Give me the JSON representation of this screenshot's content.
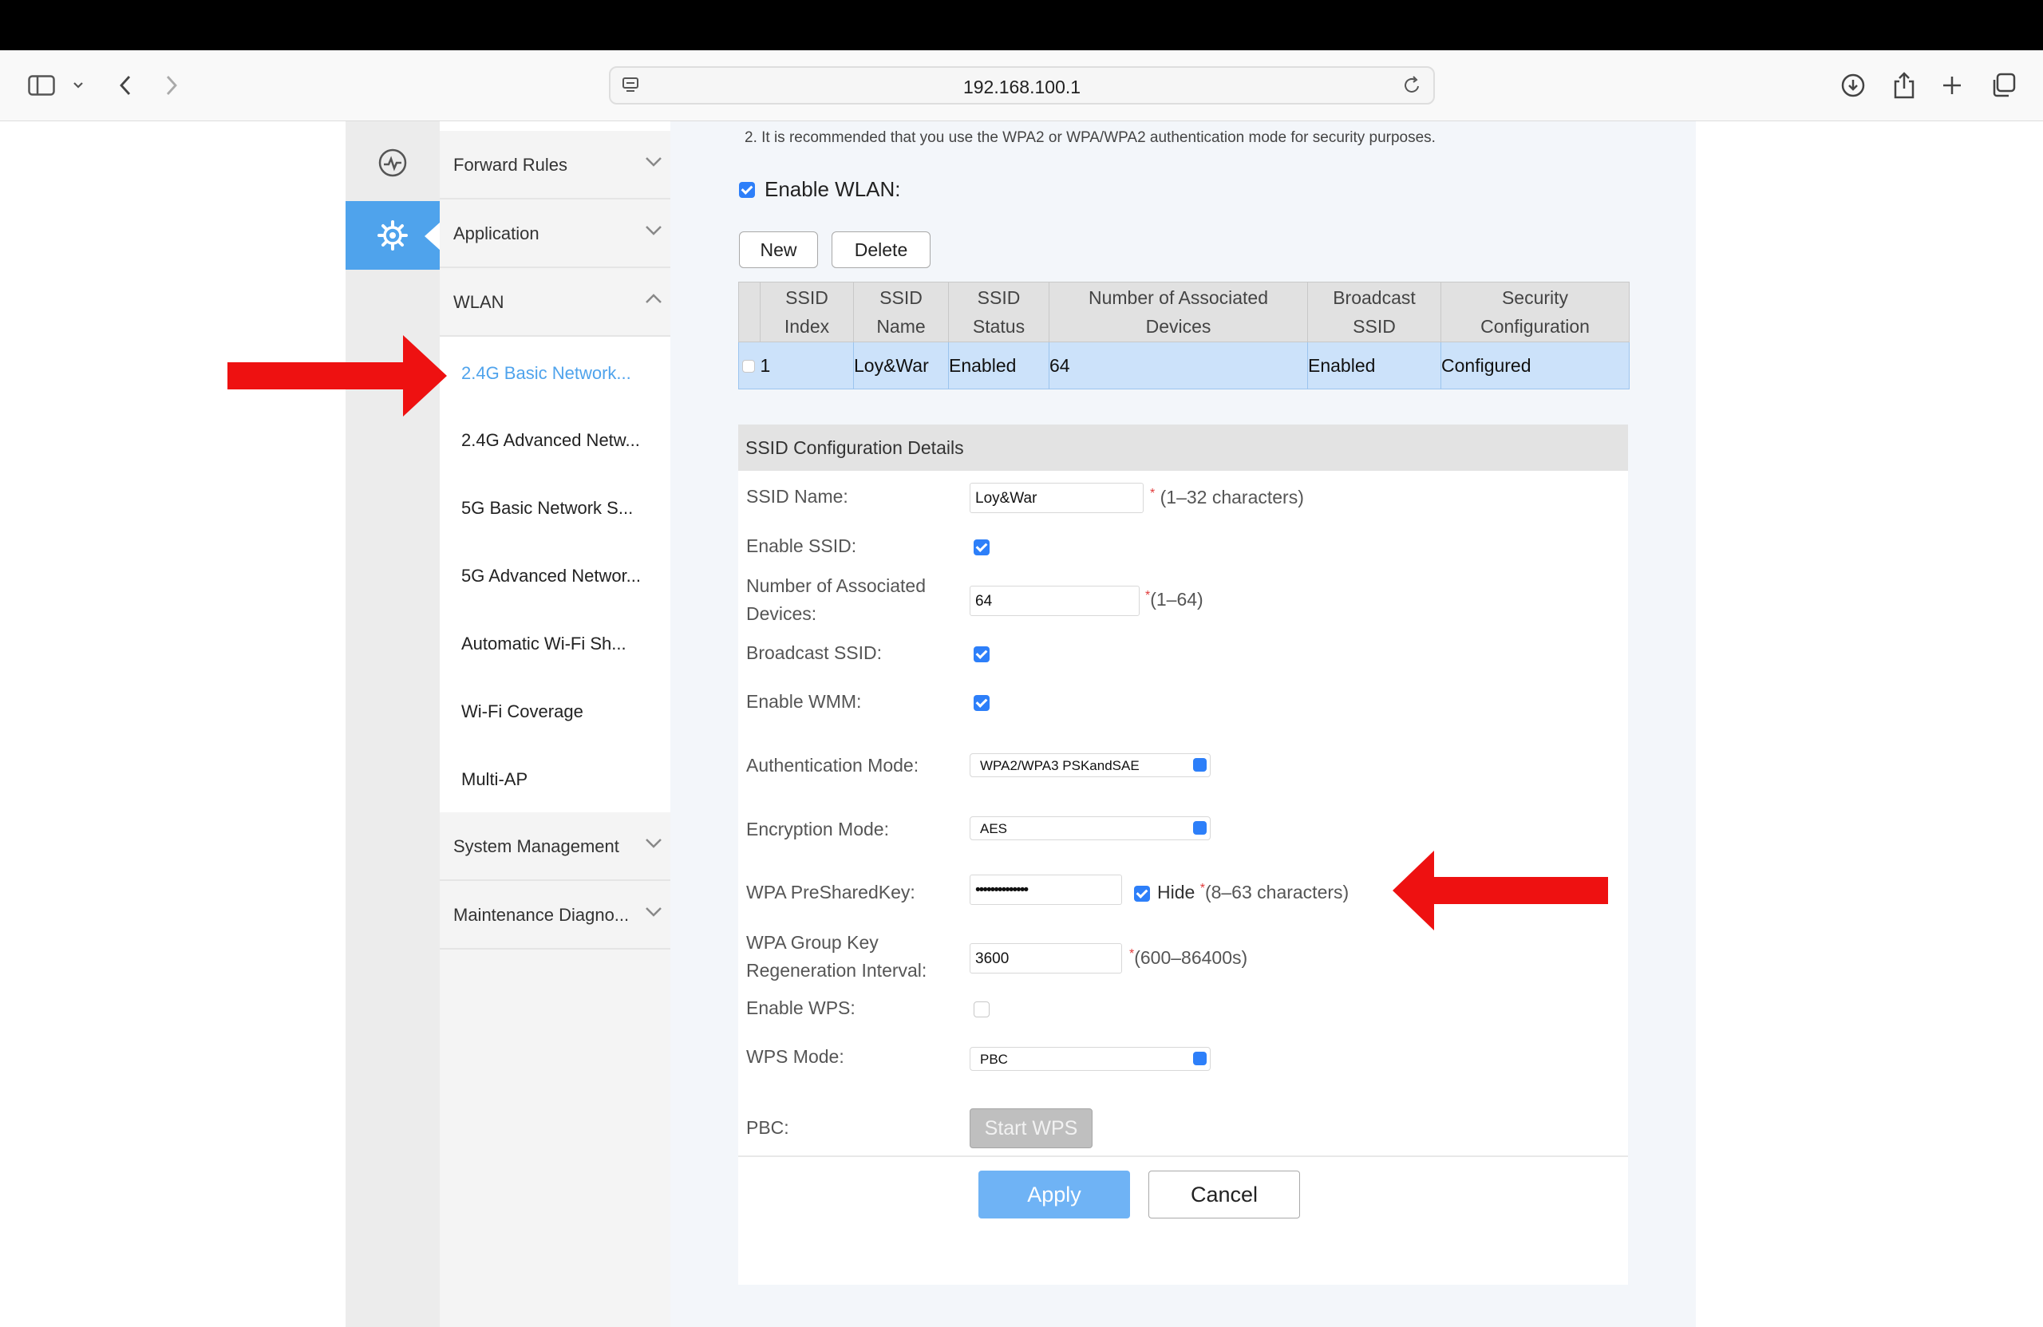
{
  "browser": {
    "url": "192.168.100.1"
  },
  "menu": {
    "items": [
      {
        "label": "Forward Rules"
      },
      {
        "label": "Application"
      },
      {
        "label": "WLAN"
      }
    ],
    "wlan_sub": [
      {
        "label": "2.4G Basic Network..."
      },
      {
        "label": "2.4G Advanced Netw..."
      },
      {
        "label": "5G Basic Network S..."
      },
      {
        "label": "5G Advanced Networ..."
      },
      {
        "label": "Automatic Wi-Fi Sh..."
      },
      {
        "label": "Wi-Fi Coverage"
      },
      {
        "label": "Multi-AP"
      }
    ],
    "bottom": [
      {
        "label": "System Management"
      },
      {
        "label": "Maintenance Diagno..."
      }
    ],
    "active_item": "2.4G Basic Network..."
  },
  "main": {
    "notice": "2. It is recommended that you use the WPA2 or WPA/WPA2 authentication mode for security purposes.",
    "enable_wlan_label": "Enable WLAN:",
    "enable_wlan_checked": true,
    "new_label": "New",
    "delete_label": "Delete",
    "table": {
      "headers": [
        {
          "l1": "SSID",
          "l2": "Index"
        },
        {
          "l1": "SSID",
          "l2": "Name"
        },
        {
          "l1": "SSID",
          "l2": "Status"
        },
        {
          "l1": "Number of Associated",
          "l2": "Devices"
        },
        {
          "l1": "Broadcast",
          "l2": "SSID"
        },
        {
          "l1": "Security",
          "l2": "Configuration"
        }
      ],
      "rows": [
        {
          "index": "1",
          "name": "Loy&War",
          "status": "Enabled",
          "devices": "64",
          "broadcast": "Enabled",
          "security": "Configured"
        }
      ]
    },
    "details": {
      "title": "SSID Configuration Details",
      "ssid_name_label": "SSID Name:",
      "ssid_name_value": "Loy&War",
      "ssid_name_note": "(1–32 characters)",
      "enable_ssid_label": "Enable SSID:",
      "enable_ssid_checked": true,
      "num_devices_label_1": "Number of Associated",
      "num_devices_label_2": "Devices:",
      "num_devices_value": "64",
      "num_devices_note": "(1–64)",
      "broadcast_label": "Broadcast SSID:",
      "broadcast_checked": true,
      "wmm_label": "Enable WMM:",
      "wmm_checked": true,
      "auth_label": "Authentication Mode:",
      "auth_value": "WPA2/WPA3 PSKandSAE",
      "enc_label": "Encryption Mode:",
      "enc_value": "AES",
      "psk_label": "WPA PreSharedKey:",
      "psk_value": "••••••••••••••",
      "hide_label": "Hide",
      "hide_checked": true,
      "psk_note": "(8–63 characters)",
      "gk_label_1": "WPA Group Key",
      "gk_label_2": "Regeneration Interval:",
      "gk_value": "3600",
      "gk_note": "(600–86400s)",
      "wps_label": "Enable WPS:",
      "wps_checked": false,
      "wps_mode_label": "WPS Mode:",
      "wps_mode_value": "PBC",
      "pbc_label": "PBC:",
      "start_wps_label": "Start WPS",
      "apply_label": "Apply",
      "cancel_label": "Cancel",
      "required_mark": "*"
    }
  },
  "colors": {
    "accent": "#4fa3ec",
    "annotation_arrow": "#ee1111",
    "selected_row": "#cce2fa",
    "apply_button": "#6fb3f5"
  }
}
